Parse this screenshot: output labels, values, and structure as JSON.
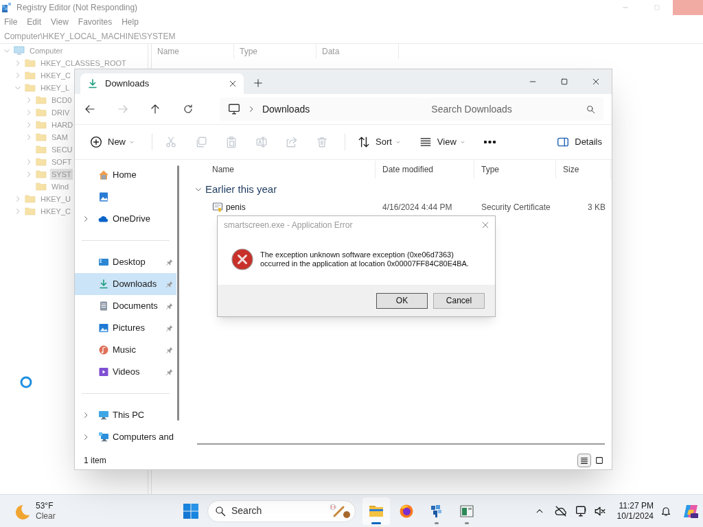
{
  "registry": {
    "title": "Registry Editor (Not Responding)",
    "menu": [
      "File",
      "Edit",
      "View",
      "Favorites",
      "Help"
    ],
    "address": "Computer\\HKEY_LOCAL_MACHINE\\SYSTEM",
    "columns": [
      "Name",
      "Type",
      "Data"
    ],
    "tree": [
      {
        "kind": "computer",
        "label": "Computer",
        "expanded": true,
        "selected": false,
        "children": [
          {
            "kind": "folder",
            "label": "HKEY_CLASSES_ROOT",
            "expanded": false,
            "selected": false
          },
          {
            "kind": "folder",
            "label": "HKEY_C",
            "expanded": false,
            "selected": false
          },
          {
            "kind": "folder",
            "label": "HKEY_L",
            "expanded": true,
            "selected": false,
            "children": [
              {
                "kind": "folder",
                "label": "BCD0",
                "expanded": false,
                "selected": false
              },
              {
                "kind": "folder",
                "label": "DRIV",
                "expanded": false,
                "selected": false
              },
              {
                "kind": "folder",
                "label": "HARD",
                "expanded": false,
                "selected": false
              },
              {
                "kind": "folder",
                "label": "SAM",
                "expanded": false,
                "selected": false
              },
              {
                "kind": "folder",
                "label": "SECU",
                "selected": false
              },
              {
                "kind": "folder",
                "label": "SOFT",
                "expanded": false,
                "selected": false
              },
              {
                "kind": "folder",
                "label": "SYST",
                "expanded": false,
                "selected": true
              },
              {
                "kind": "folder",
                "label": "Wind",
                "selected": false
              }
            ]
          },
          {
            "kind": "folder",
            "label": "HKEY_U",
            "expanded": false,
            "selected": false
          },
          {
            "kind": "folder",
            "label": "HKEY_C",
            "expanded": false,
            "selected": false
          }
        ]
      }
    ]
  },
  "explorer": {
    "tabs": [
      {
        "label": "Downloads",
        "selected": true
      }
    ],
    "nav": [
      {
        "kind": "back",
        "disabled": false
      },
      {
        "kind": "forward",
        "disabled": true
      },
      {
        "kind": "up",
        "disabled": false
      },
      {
        "kind": "refresh",
        "disabled": false
      }
    ],
    "breadcrumb": [
      "Downloads"
    ],
    "search": {
      "placeholder": "Search Downloads"
    },
    "commands": [
      [
        {
          "kind": "new",
          "label": "New",
          "disabled": false
        }
      ],
      [
        {
          "kind": "cut",
          "disabled": true
        },
        {
          "kind": "copy",
          "disabled": true
        },
        {
          "kind": "paste",
          "disabled": true
        },
        {
          "kind": "rename",
          "disabled": true
        },
        {
          "kind": "share",
          "disabled": true
        },
        {
          "kind": "delete",
          "disabled": true
        }
      ],
      [
        {
          "kind": "sort",
          "label": "Sort",
          "disabled": false
        },
        {
          "kind": "view",
          "label": "View",
          "disabled": false
        },
        {
          "kind": "more",
          "disabled": false
        }
      ]
    ],
    "details_button": {
      "label": "Details"
    },
    "sidebar": [
      [
        {
          "kind": "home",
          "label": "Home",
          "selected": false
        },
        {
          "kind": "gallery",
          "selected": false
        },
        {
          "kind": "onedrive",
          "label": "OneDrive",
          "expanded": false,
          "selected": false
        }
      ],
      [
        {
          "kind": "desktop",
          "label": "Desktop",
          "pinned": true,
          "selected": false
        },
        {
          "kind": "downloads",
          "label": "Downloads",
          "pinned": true,
          "selected": true
        },
        {
          "kind": "documents",
          "label": "Documents",
          "pinned": true,
          "selected": false
        },
        {
          "kind": "pictures",
          "label": "Pictures",
          "pinned": true,
          "selected": false
        },
        {
          "kind": "music",
          "label": "Music",
          "pinned": true,
          "selected": false
        },
        {
          "kind": "videos",
          "label": "Videos",
          "pinned": true,
          "selected": false
        }
      ],
      [
        {
          "kind": "thispc",
          "label": "This PC",
          "expanded": false,
          "selected": false
        },
        {
          "kind": "network",
          "label": "Computers and",
          "expanded": false,
          "selected": false
        }
      ]
    ],
    "columns": [
      "Name",
      "Date modified",
      "Type",
      "Size"
    ],
    "groups": [
      {
        "label": "Earlier this year",
        "expanded": true,
        "files": [
          {
            "name": "penis",
            "date": "4/16/2024 4:44 PM",
            "type": "Security Certificate",
            "size": "3 KB",
            "selected": false
          }
        ]
      }
    ],
    "status": "1 item",
    "view_modes": [
      {
        "kind": "details",
        "selected": true
      },
      {
        "kind": "tiles",
        "selected": false
      }
    ]
  },
  "dialog": {
    "title": "smartscreen.exe - Application Error",
    "message": "The exception unknown software exception (0xe06d7363)\noccurred in the application at location 0x00007FF84C80E4BA.",
    "buttons": [
      {
        "label": "OK",
        "default": true
      },
      {
        "label": "Cancel",
        "default": false
      }
    ]
  },
  "taskbar": {
    "weather": {
      "temperature": "53°F",
      "condition": "Clear"
    },
    "search": {
      "placeholder": "Search"
    },
    "apps": [
      {
        "kind": "explorer",
        "active": true,
        "running": true
      },
      {
        "kind": "firefox",
        "active": false,
        "running": false
      },
      {
        "kind": "cubes",
        "active": false,
        "running": true
      },
      {
        "kind": "window",
        "active": false,
        "running": true
      }
    ],
    "clock": {
      "time": "11:27 PM",
      "date": "10/1/2024"
    }
  }
}
